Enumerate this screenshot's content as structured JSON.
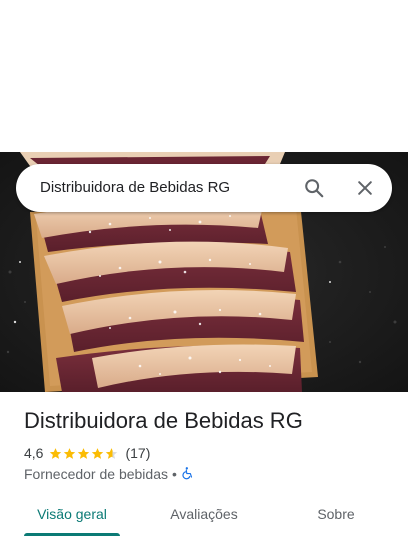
{
  "search": {
    "query": "Distribuidora de Bebidas RG"
  },
  "place": {
    "title": "Distribuidora de Bebidas RG",
    "rating": "4,6",
    "stars": 4.6,
    "review_count": "(17)",
    "category": "Fornecedor de bebidas",
    "separator": "•"
  },
  "tabs": [
    {
      "label": "Visão geral",
      "active": true
    },
    {
      "label": "Avaliações",
      "active": false
    },
    {
      "label": "Sobre",
      "active": false
    }
  ],
  "icons": {
    "search": "search-icon",
    "close": "close-icon",
    "accessibility": "wheelchair-icon",
    "photo": "meat-cuts-on-wooden-board-photo"
  },
  "colors": {
    "star": "#fbbc04",
    "active_tab": "#0b7a75",
    "accessibility": "#1a73e8"
  }
}
